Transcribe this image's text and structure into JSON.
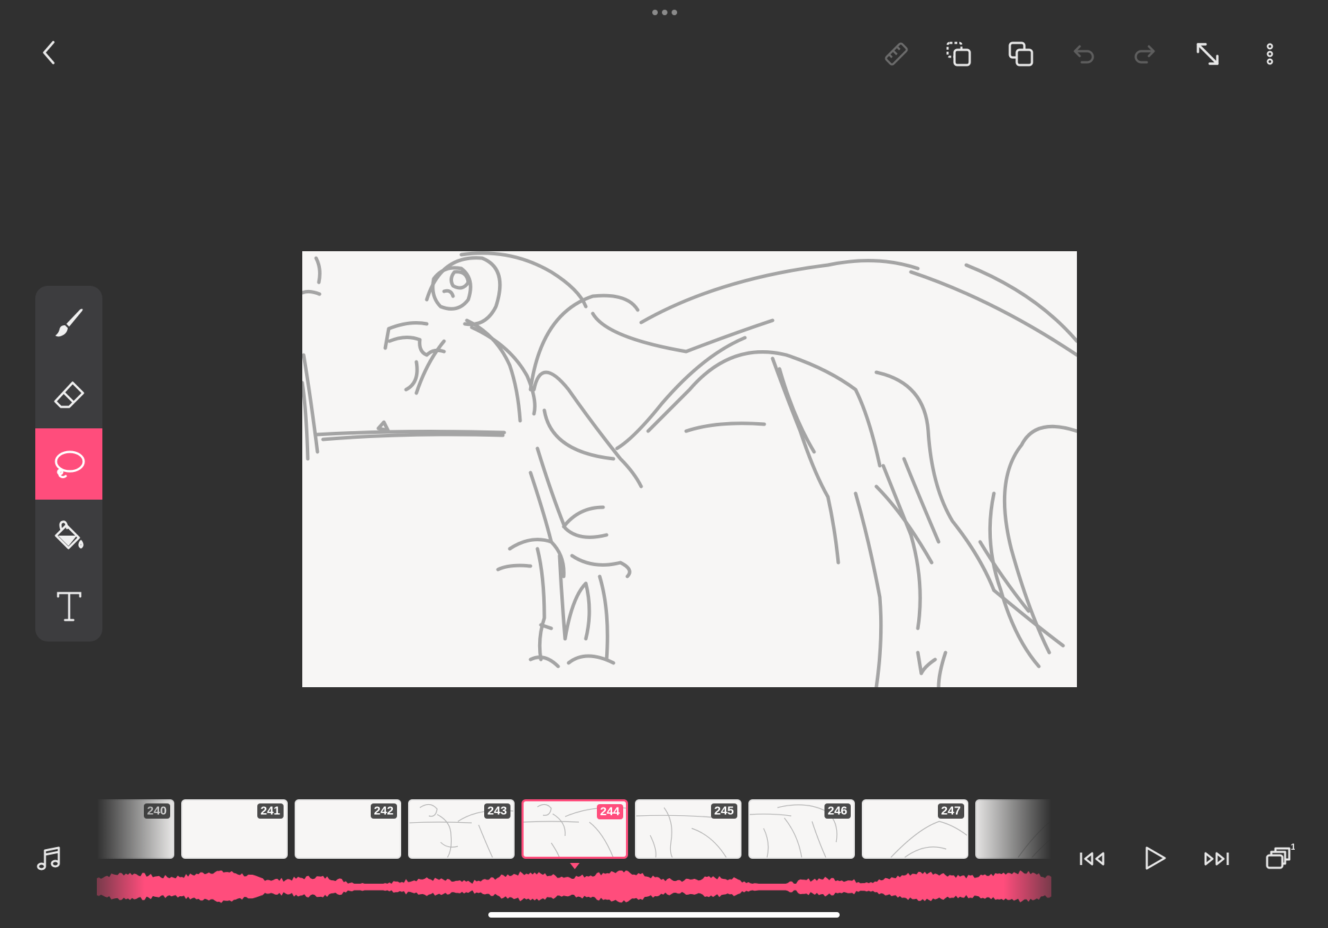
{
  "topbar": {
    "back_icon": "chevron-left-icon",
    "actions": [
      {
        "icon": "ruler-icon",
        "enabled": false
      },
      {
        "icon": "duplicate-selection-icon",
        "enabled": true
      },
      {
        "icon": "copy-layers-icon",
        "enabled": true
      },
      {
        "icon": "undo-icon",
        "enabled": false
      },
      {
        "icon": "redo-icon",
        "enabled": false
      },
      {
        "icon": "expand-icon",
        "enabled": true
      },
      {
        "icon": "more-vertical-icon",
        "enabled": true
      }
    ]
  },
  "tools": [
    {
      "name": "brush",
      "icon": "brush-icon",
      "active": false
    },
    {
      "name": "eraser",
      "icon": "eraser-icon",
      "active": false
    },
    {
      "name": "lasso",
      "icon": "lasso-icon",
      "active": true
    },
    {
      "name": "fill",
      "icon": "paint-bucket-icon",
      "active": false
    },
    {
      "name": "text",
      "icon": "text-icon",
      "active": false
    }
  ],
  "timeline": {
    "frames": [
      {
        "number": "240"
      },
      {
        "number": "241"
      },
      {
        "number": "242"
      },
      {
        "number": "243"
      },
      {
        "number": "244"
      },
      {
        "number": "245"
      },
      {
        "number": "246"
      },
      {
        "number": "247"
      }
    ],
    "current_frame": "244",
    "onion_skin_count": "1"
  },
  "playback": {
    "audio_icon": "music-note-icon",
    "first_frame_icon": "skip-to-start-icon",
    "play_icon": "play-icon",
    "last_frame_icon": "skip-to-end-icon",
    "onion_icon": "onion-skin-layers-icon"
  },
  "colors": {
    "background": "#303030",
    "accent": "#ff4d7c",
    "panel": "#3d3d3f",
    "canvas": "#f7f6f5",
    "sketch_stroke": "#a4a4a4"
  }
}
